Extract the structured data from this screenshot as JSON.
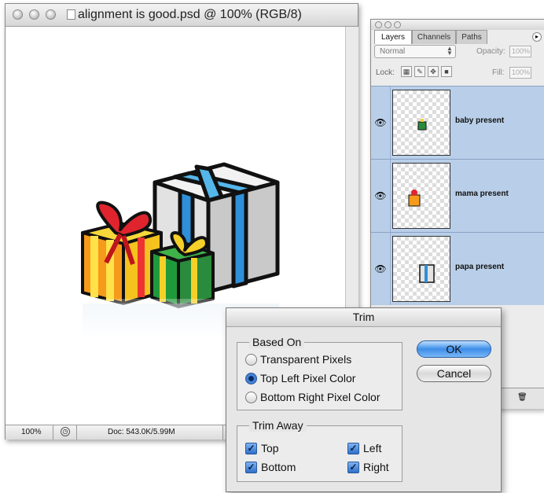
{
  "document_window": {
    "title": "alignment is good.psd @ 100% (RGB/8)",
    "status": {
      "zoom": "100%",
      "doc_info": "Doc: 543.0K/5.99M"
    }
  },
  "layers_palette": {
    "tabs": [
      "Layers",
      "Channels",
      "Paths"
    ],
    "blend_mode": "Normal",
    "opacity_label": "Opacity:",
    "opacity_value": "100%",
    "lock_label": "Lock:",
    "fill_label": "Fill:",
    "fill_value": "100%",
    "layers": [
      {
        "name": "baby present",
        "visible": true,
        "selected": true
      },
      {
        "name": "mama present",
        "visible": true,
        "selected": true
      },
      {
        "name": "papa present",
        "visible": true,
        "selected": true
      }
    ]
  },
  "trim_dialog": {
    "title": "Trim",
    "based_on": {
      "label": "Based On",
      "options": [
        "Transparent Pixels",
        "Top Left Pixel Color",
        "Bottom Right Pixel Color"
      ],
      "selected": "Top Left Pixel Color"
    },
    "trim_away": {
      "label": "Trim Away",
      "top": {
        "label": "Top",
        "checked": true
      },
      "bottom": {
        "label": "Bottom",
        "checked": true
      },
      "left": {
        "label": "Left",
        "checked": true
      },
      "right": {
        "label": "Right",
        "checked": true
      }
    },
    "ok_label": "OK",
    "cancel_label": "Cancel"
  },
  "colors": {
    "selection_blue": "#b9cfe9",
    "ok_button_blue": "#3d8de8"
  }
}
